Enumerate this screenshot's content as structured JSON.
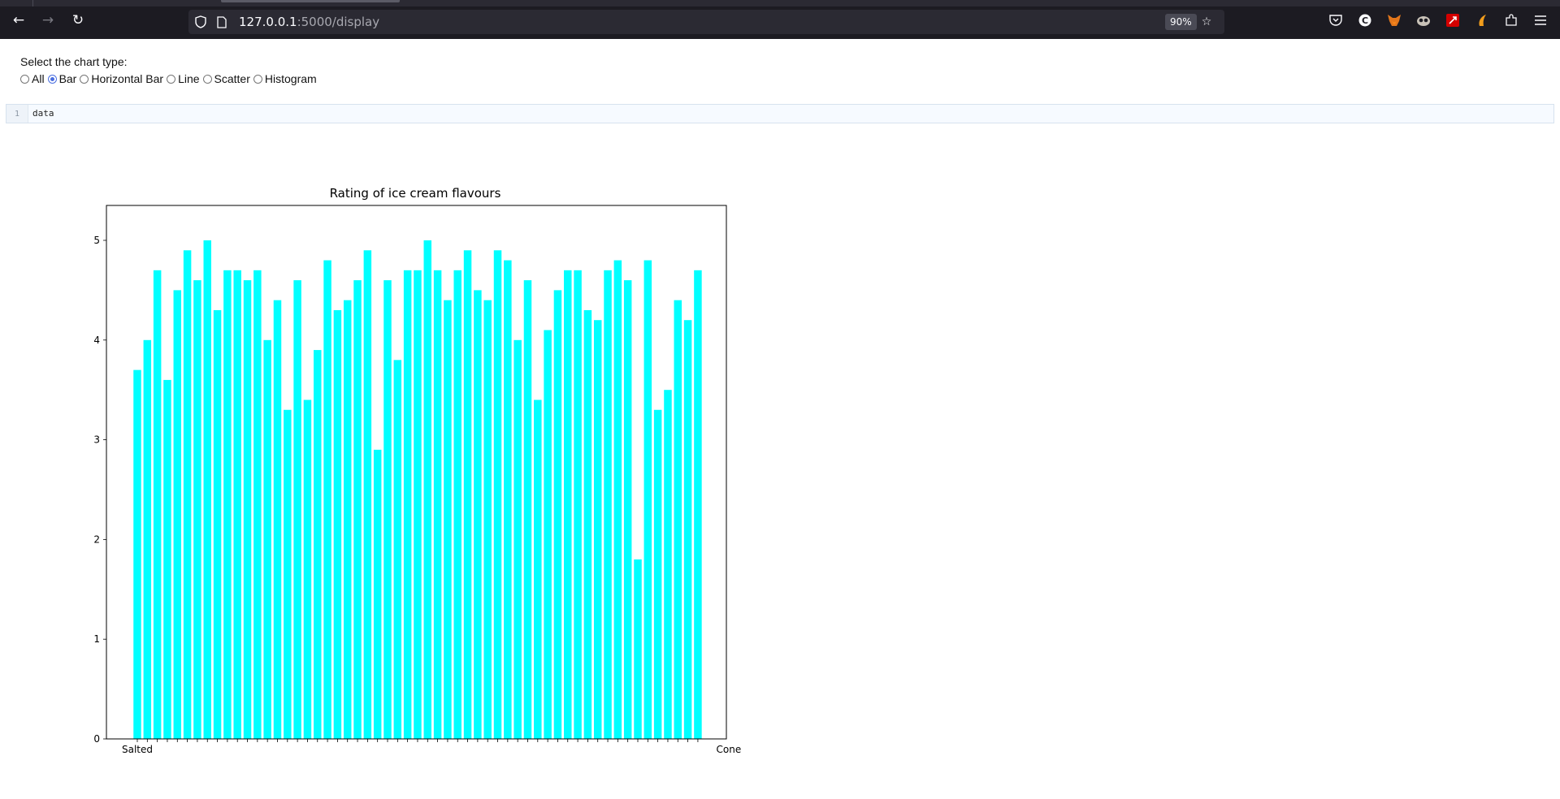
{
  "browser": {
    "url_host": "127.0.0.1",
    "url_path": ":5000/display",
    "zoom_level": "90%",
    "icons": [
      "back-arrow-icon",
      "forward-arrow-icon",
      "reload-icon",
      "shield-icon",
      "page-icon",
      "bookmark-star-icon",
      "pocket-icon",
      "extension-c-icon",
      "metamask-fox-icon",
      "owl-extension-icon",
      "red-extension-icon",
      "orange-extension-icon",
      "extensions-puzzle-icon",
      "menu-icon"
    ]
  },
  "controls": {
    "prompt": "Select the chart type:",
    "options": [
      {
        "label": "All",
        "checked": false
      },
      {
        "label": "Bar",
        "checked": true
      },
      {
        "label": "Horizontal Bar",
        "checked": false
      },
      {
        "label": "Line",
        "checked": false
      },
      {
        "label": "Scatter",
        "checked": false
      },
      {
        "label": "Histogram",
        "checked": false
      }
    ]
  },
  "editor": {
    "line_number": "1",
    "code": "data"
  },
  "chart_data": {
    "type": "bar",
    "title": "Rating of ice cream flavours",
    "xlabel": "",
    "ylabel": "",
    "ylim": [
      0,
      5.35
    ],
    "yticks": [
      0,
      1,
      2,
      3,
      4,
      5
    ],
    "bar_color": "#00ffff",
    "grid": false,
    "first_category": "Salted",
    "last_category": "Cone",
    "values": [
      3.7,
      4.0,
      4.7,
      3.6,
      4.5,
      4.9,
      4.6,
      5.0,
      4.3,
      4.7,
      4.7,
      4.6,
      4.7,
      4.0,
      4.4,
      3.3,
      4.6,
      3.4,
      3.9,
      4.8,
      4.3,
      4.4,
      4.6,
      4.9,
      2.9,
      4.6,
      3.8,
      4.7,
      4.7,
      5.0,
      4.7,
      4.4,
      4.7,
      4.9,
      4.5,
      4.4,
      4.9,
      4.8,
      4.0,
      4.6,
      3.4,
      4.1,
      4.5,
      4.7,
      4.7,
      4.3,
      4.2,
      4.7,
      4.8,
      4.6,
      1.8,
      4.8,
      3.3,
      3.5,
      4.4,
      4.2,
      4.7
    ]
  }
}
